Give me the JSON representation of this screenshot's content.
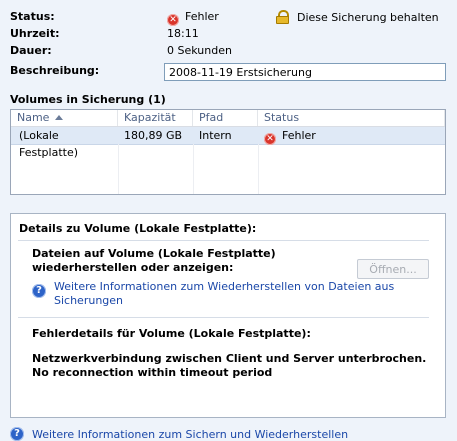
{
  "summary": {
    "status_label": "Status:",
    "status_value": "Fehler",
    "time_label": "Uhrzeit:",
    "time_value": "18:11",
    "duration_label": "Dauer:",
    "duration_value": "0 Sekunden",
    "description_label": "Beschreibung:",
    "description_value": "2008-11-19 Erstsicherung"
  },
  "keep_backup_label": "Diese Sicherung behalten",
  "volumes": {
    "title": "Volumes in Sicherung (1)",
    "columns": [
      "Name",
      "Kapazität",
      "Pfad",
      "Status"
    ],
    "rows": [
      {
        "name": "(Lokale Festplatte)",
        "capacity": "180,89 GB",
        "path": "Intern",
        "status": "Fehler"
      }
    ]
  },
  "details": {
    "title": "Details zu Volume  (Lokale Festplatte):",
    "restore_text_line1": "Dateien auf Volume  (Lokale Festplatte)",
    "restore_text_line2": "wiederherstellen oder anzeigen:",
    "open_button": "Öffnen...",
    "info_link_line1": "Weitere Informationen zum Wiederherstellen von Dateien aus",
    "info_link_line2": "Sicherungen",
    "error_details_title": "Fehlerdetails für Volume  (Lokale Festplatte):",
    "error_line1": "Netzwerkverbindung zwischen Client und Server unterbrochen.",
    "error_line2": "No reconnection within timeout period"
  },
  "bottom_link": "Weitere Informationen zum Sichern und Wiederherstellen"
}
